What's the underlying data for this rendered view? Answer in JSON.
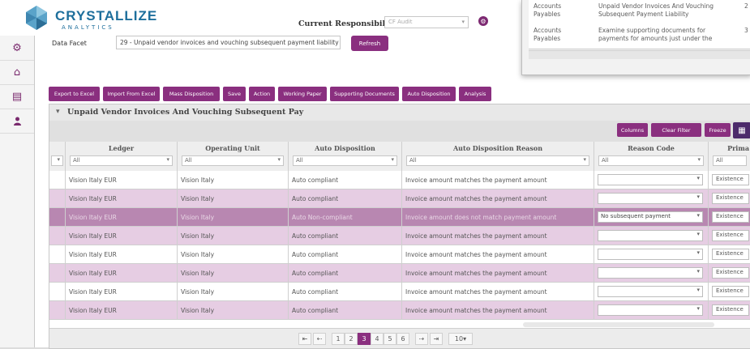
{
  "brand": {
    "name": "CRYSTALLIZE",
    "tagline": "ANALYTICS"
  },
  "header": {
    "responsibility_label": "Current Responsibility",
    "responsibility_value": "CF Audit",
    "facet_label": "Data Facet",
    "facet_value": "29 - Unpaid vendor invoices and vouching subsequent payment liability",
    "refresh_label": "Refresh"
  },
  "overlay": {
    "rows": [
      {
        "area": "Accounts Payables",
        "description": "Unpaid Vendor Invoices And Vouching Subsequent Payment Liability",
        "num": "2"
      },
      {
        "area": "Accounts Payables",
        "description": "Examine supporting documents for payments for amounts just under the",
        "num": "3"
      }
    ]
  },
  "toolbar": {
    "buttons": [
      "Export to Excel",
      "Import From Excel",
      "Mass Disposition",
      "Save",
      "Action",
      "Working Paper",
      "Supporting Documents",
      "Auto Disposition",
      "Analysis"
    ]
  },
  "panel": {
    "title": "Unpaid Vendor Invoices And Vouching Subsequent Pay",
    "grid_buttons": [
      "Columns",
      "Clear Filter",
      "Freeze"
    ]
  },
  "table": {
    "columns": [
      "Ledger",
      "Operating Unit",
      "Auto Disposition",
      "Auto Disposition Reason",
      "Reason Code",
      "Prima"
    ],
    "filter_value": "All",
    "rows": [
      {
        "ledger": "Vision Italy EUR",
        "unit": "Vision Italy",
        "disp": "Auto compliant",
        "reason": "Invoice amount matches the payment amount",
        "code": "",
        "primary": "Existence"
      },
      {
        "ledger": "Vision Italy EUR",
        "unit": "Vision Italy",
        "disp": "Auto compliant",
        "reason": "Invoice amount matches the payment amount",
        "code": "",
        "primary": "Existence"
      },
      {
        "ledger": "Vision Italy EUR",
        "unit": "Vision Italy",
        "disp": "Auto Non-compliant",
        "reason": "Invoice amount does not match payment amount",
        "code": "No subsequent payment",
        "primary": "Existence"
      },
      {
        "ledger": "Vision Italy EUR",
        "unit": "Vision Italy",
        "disp": "Auto compliant",
        "reason": "Invoice amount matches the payment amount",
        "code": "",
        "primary": "Existence"
      },
      {
        "ledger": "Vision Italy EUR",
        "unit": "Vision Italy",
        "disp": "Auto compliant",
        "reason": "Invoice amount matches the payment amount",
        "code": "",
        "primary": "Existence"
      },
      {
        "ledger": "Vision Italy EUR",
        "unit": "Vision Italy",
        "disp": "Auto compliant",
        "reason": "Invoice amount matches the payment amount",
        "code": "",
        "primary": "Existence"
      },
      {
        "ledger": "Vision Italy EUR",
        "unit": "Vision Italy",
        "disp": "Auto compliant",
        "reason": "Invoice amount matches the payment amount",
        "code": "",
        "primary": "Existence"
      },
      {
        "ledger": "Vision Italy EUR",
        "unit": "Vision Italy",
        "disp": "Auto compliant",
        "reason": "Invoice amount matches the payment amount",
        "code": "",
        "primary": "Existence"
      }
    ]
  },
  "pager": {
    "first": "⇤",
    "prev": "⇠",
    "pages": [
      "1",
      "2",
      "3",
      "4",
      "5",
      "6"
    ],
    "current": "3",
    "next": "⇢",
    "last": "⇥",
    "page_size": "10"
  },
  "colors": {
    "accent": "#8a2f7f",
    "row_pink": "#e6cde3",
    "row_highlight": "#b887b1",
    "brand_blue": "#1e6f9c"
  },
  "icons": {
    "rail": [
      "gear-icon",
      "home-icon",
      "document-icon",
      "user-icon"
    ]
  }
}
